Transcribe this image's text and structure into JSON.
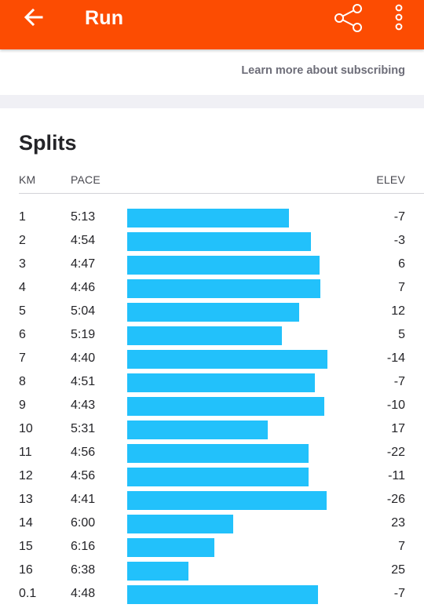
{
  "header": {
    "title": "Run",
    "bar_color": "#fc4c02",
    "icons": [
      "back-arrow-icon",
      "share-icon",
      "more-vertical-icon"
    ]
  },
  "subscription": {
    "link_text": "Learn more about subscribing"
  },
  "splits": {
    "title": "Splits",
    "columns": {
      "km": "KM",
      "pace": "PACE",
      "elev": "ELEV"
    },
    "bar_color": "#22c1fb",
    "rows": [
      {
        "km": "1",
        "pace": "5:13",
        "elev": "-7",
        "pace_seconds": 313
      },
      {
        "km": "2",
        "pace": "4:54",
        "elev": "-3",
        "pace_seconds": 294
      },
      {
        "km": "3",
        "pace": "4:47",
        "elev": "6",
        "pace_seconds": 287
      },
      {
        "km": "4",
        "pace": "4:46",
        "elev": "7",
        "pace_seconds": 286
      },
      {
        "km": "5",
        "pace": "5:04",
        "elev": "12",
        "pace_seconds": 304
      },
      {
        "km": "6",
        "pace": "5:19",
        "elev": "5",
        "pace_seconds": 319
      },
      {
        "km": "7",
        "pace": "4:40",
        "elev": "-14",
        "pace_seconds": 280
      },
      {
        "km": "8",
        "pace": "4:51",
        "elev": "-7",
        "pace_seconds": 291
      },
      {
        "km": "9",
        "pace": "4:43",
        "elev": "-10",
        "pace_seconds": 283
      },
      {
        "km": "10",
        "pace": "5:31",
        "elev": "17",
        "pace_seconds": 331
      },
      {
        "km": "11",
        "pace": "4:56",
        "elev": "-22",
        "pace_seconds": 296
      },
      {
        "km": "12",
        "pace": "4:56",
        "elev": "-11",
        "pace_seconds": 296
      },
      {
        "km": "13",
        "pace": "4:41",
        "elev": "-26",
        "pace_seconds": 281
      },
      {
        "km": "14",
        "pace": "6:00",
        "elev": "23",
        "pace_seconds": 360
      },
      {
        "km": "15",
        "pace": "6:16",
        "elev": "7",
        "pace_seconds": 376
      },
      {
        "km": "16",
        "pace": "6:38",
        "elev": "25",
        "pace_seconds": 398
      },
      {
        "km": "0.1",
        "pace": "4:48",
        "elev": "-7",
        "pace_seconds": 288
      }
    ]
  }
}
